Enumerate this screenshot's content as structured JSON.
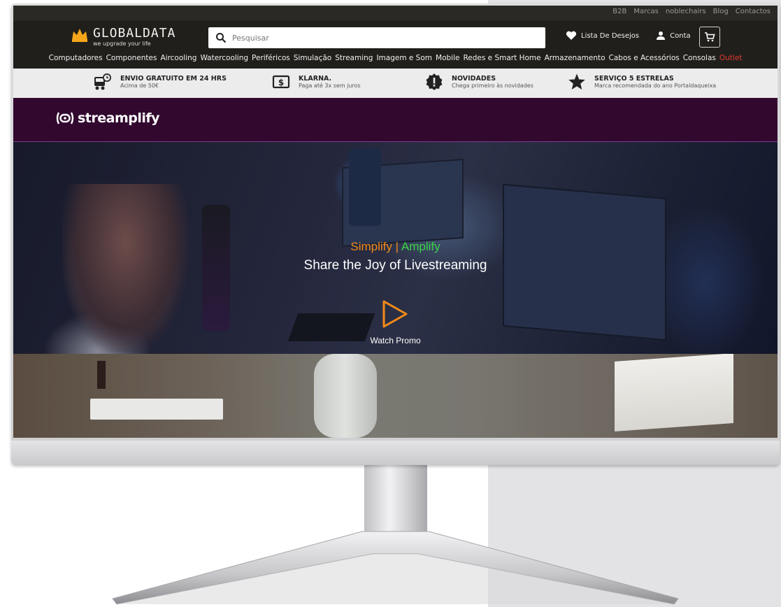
{
  "top_links": [
    "B2B",
    "Marcas",
    "noblechairs",
    "Blog",
    "Contactos"
  ],
  "logo": {
    "name": "GLOBALDATA",
    "tagline": "we upgrade your life"
  },
  "search": {
    "placeholder": "Pesquisar"
  },
  "header_actions": {
    "wishlist": "Lista De Desejos",
    "account": "Conta"
  },
  "nav": [
    "Computadores",
    "Componentes",
    "Aircooling",
    "Watercooling",
    "Periféricos",
    "Simulação",
    "Streaming",
    "Imagem e Som",
    "Mobile",
    "Redes e Smart Home",
    "Armazenamento",
    "Cabos e Acessórios",
    "Consolas",
    "Outlet"
  ],
  "benefits": [
    {
      "title": "ENVIO GRATUITO EM 24 HRS",
      "subtitle": "Acima de 50€",
      "icon": "delivery-truck-icon"
    },
    {
      "title": "KLARNA.",
      "subtitle": "Paga até 3x sem juros",
      "icon": "dollar-icon"
    },
    {
      "title": "NOVIDADES",
      "subtitle": "Chega primeiro às novidades",
      "icon": "alert-badge-icon"
    },
    {
      "title": "SERVIÇO 5 ESTRELAS",
      "subtitle": "Marca recomendada do ano Portaldaqueixa",
      "icon": "star-icon"
    }
  ],
  "brand": {
    "name": "streamplify"
  },
  "hero": {
    "tagline_simplify": "Simplify",
    "tagline_separator": "|",
    "tagline_amplify": "Amplify",
    "subtitle": "Share the Joy of Livestreaming",
    "cta": "Watch Promo"
  },
  "colors": {
    "accent_orange": "#f28a1a",
    "accent_green": "#3ad34a",
    "outlet_red": "#e03a2c",
    "brand_purple": "#32082f"
  }
}
